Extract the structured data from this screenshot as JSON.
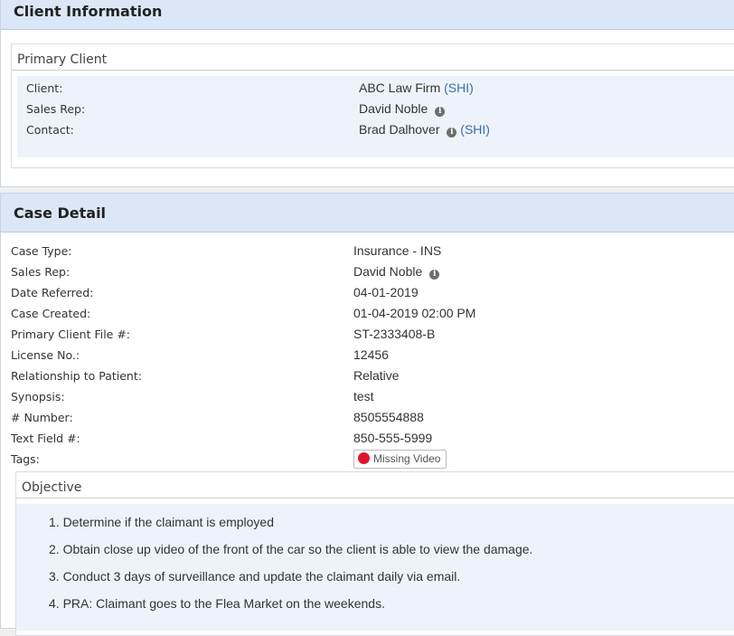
{
  "client_section": {
    "title": "Client Information",
    "primary_client": {
      "legend": "Primary Client",
      "rows": [
        {
          "label": "Client:",
          "value": "ABC Law Firm",
          "link": "(SHI)",
          "info": false
        },
        {
          "label": "Sales Rep:",
          "value": "David Noble",
          "link": "",
          "info": true
        },
        {
          "label": "Contact:",
          "value": "Brad Dalhover",
          "link": "(SHI)",
          "info": true
        }
      ]
    }
  },
  "case_section": {
    "title": "Case Detail",
    "fields": {
      "case_type": {
        "label": "Case Type:",
        "value": "Insurance - INS"
      },
      "sales_rep": {
        "label": "Sales Rep:",
        "value": "David Noble"
      },
      "date_referred": {
        "label": "Date Referred:",
        "value": "04-01-2019"
      },
      "case_created": {
        "label": "Case Created:",
        "value": "01-04-2019 02:00 PM"
      },
      "primary_client_file": {
        "label": "Primary Client File #:",
        "value": "ST-2333408-B"
      },
      "license_no": {
        "label": "License No.:",
        "value": "12456"
      },
      "relationship": {
        "label": "Relationship to Patient:",
        "value": "Relative"
      },
      "synopsis": {
        "label": "Synopsis:",
        "value": "test"
      },
      "number": {
        "label": "# Number:",
        "value": "8505554888"
      },
      "text_field": {
        "label": "Text Field #:",
        "value": "850-555-5999"
      },
      "tags": {
        "label": "Tags:",
        "tag_label": "Missing Video",
        "tag_color": "#e0142d"
      }
    },
    "objective": {
      "legend": "Objective",
      "items": [
        "1. Determine if the claimant is employed",
        "2. Obtain close up video of the front of the car so the client is able to view the damage.",
        "3. Conduct 3 days of surveillance and update the claimant daily via email.",
        "4. PRA: Claimant goes to the Flea Market on the weekends."
      ]
    }
  },
  "colors": {
    "header_bg": "#dbe7f7",
    "kv_bg": "#eef3fb",
    "link": "#3a6fa8",
    "tag_dot": "#e0142d"
  },
  "icons": {
    "info": "info-icon"
  }
}
